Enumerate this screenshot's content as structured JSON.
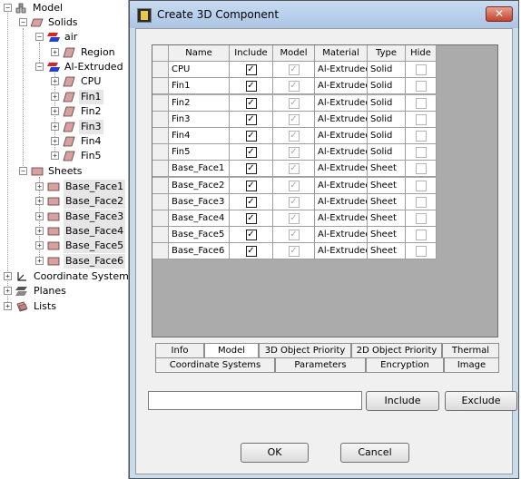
{
  "tree": {
    "model": "Model",
    "solids": "Solids",
    "air": "air",
    "region": "Region",
    "al_extruded": "Al-Extruded",
    "cpu": "CPU",
    "fins": [
      "Fin1",
      "Fin2",
      "Fin3",
      "Fin4",
      "Fin5"
    ],
    "sheets": "Sheets",
    "faces": [
      "Base_Face1",
      "Base_Face2",
      "Base_Face3",
      "Base_Face4",
      "Base_Face5",
      "Base_Face6"
    ],
    "coordinate_systems": "Coordinate Systems",
    "planes": "Planes",
    "lists": "Lists"
  },
  "dialog": {
    "title": "Create 3D Component",
    "close": "✕"
  },
  "grid": {
    "headers": [
      "Name",
      "Include",
      "Model",
      "Material",
      "Type",
      "Hide"
    ],
    "rows": [
      {
        "name": "CPU",
        "material": "Al-Extruded",
        "type": "Solid"
      },
      {
        "name": "Fin1",
        "material": "Al-Extruded",
        "type": "Solid"
      },
      {
        "name": "Fin2",
        "material": "Al-Extruded",
        "type": "Solid"
      },
      {
        "name": "Fin3",
        "material": "Al-Extruded",
        "type": "Solid"
      },
      {
        "name": "Fin4",
        "material": "Al-Extruded",
        "type": "Solid"
      },
      {
        "name": "Fin5",
        "material": "Al-Extruded",
        "type": "Solid"
      },
      {
        "name": "Base_Face1",
        "material": "Al-Extruded",
        "type": "Sheet"
      },
      {
        "name": "Base_Face2",
        "material": "Al-Extruded",
        "type": "Sheet"
      },
      {
        "name": "Base_Face3",
        "material": "Al-Extruded",
        "type": "Sheet"
      },
      {
        "name": "Base_Face4",
        "material": "Al-Extruded",
        "type": "Sheet"
      },
      {
        "name": "Base_Face5",
        "material": "Al-Extruded",
        "type": "Sheet"
      },
      {
        "name": "Base_Face6",
        "material": "Al-Extruded",
        "type": "Sheet"
      }
    ],
    "check_mark": "✓"
  },
  "tabs": {
    "row1": [
      "Info",
      "Model",
      "3D Object Priority",
      "2D Object Priority",
      "Thermal"
    ],
    "row2": [
      "Coordinate Systems",
      "Parameters",
      "Encryption",
      "Image"
    ],
    "active": "Model"
  },
  "buttons": {
    "include": "Include",
    "exclude": "Exclude",
    "ok": "OK",
    "cancel": "Cancel"
  },
  "colors": {
    "dialog_frame": "#c9dcee",
    "close_button": "#c2422b"
  }
}
